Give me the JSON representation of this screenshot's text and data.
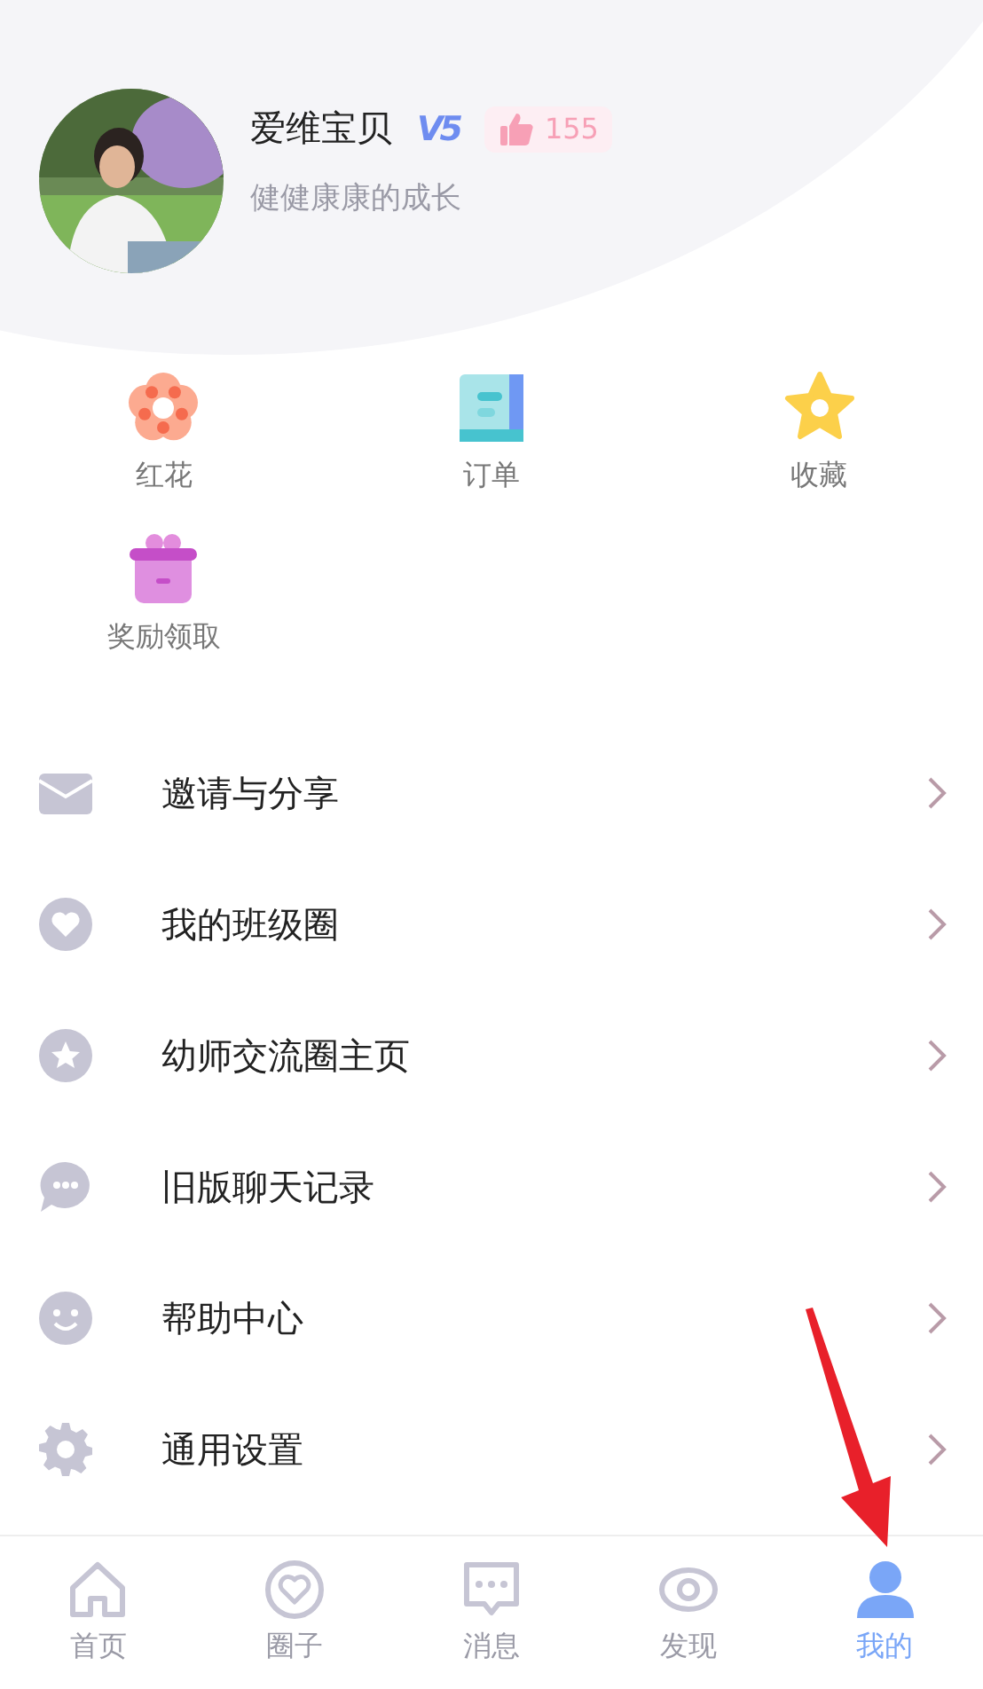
{
  "profile": {
    "name": "爱维宝贝",
    "level_badge": "V5",
    "likes": "155",
    "motto": "健健康康的成长"
  },
  "shortcuts": [
    {
      "label": "红花",
      "kind": "flower"
    },
    {
      "label": "订单",
      "kind": "order"
    },
    {
      "label": "收藏",
      "kind": "star"
    },
    {
      "label": "奖励领取",
      "kind": "gift"
    }
  ],
  "menu": [
    {
      "label": "邀请与分享",
      "kind": "mail"
    },
    {
      "label": "我的班级圈",
      "kind": "heart"
    },
    {
      "label": "幼师交流圈主页",
      "kind": "star"
    },
    {
      "label": "旧版聊天记录",
      "kind": "chat"
    },
    {
      "label": "帮助中心",
      "kind": "smile"
    },
    {
      "label": "通用设置",
      "kind": "gear"
    }
  ],
  "tab_bar": [
    {
      "label": "首页",
      "kind": "home",
      "selected": false
    },
    {
      "label": "圈子",
      "kind": "circle",
      "selected": false
    },
    {
      "label": "消息",
      "kind": "chat",
      "selected": false
    },
    {
      "label": "发现",
      "kind": "eye",
      "selected": false
    },
    {
      "label": "我的",
      "kind": "person",
      "selected": true
    }
  ],
  "annotation": {
    "kind": "arrow"
  }
}
